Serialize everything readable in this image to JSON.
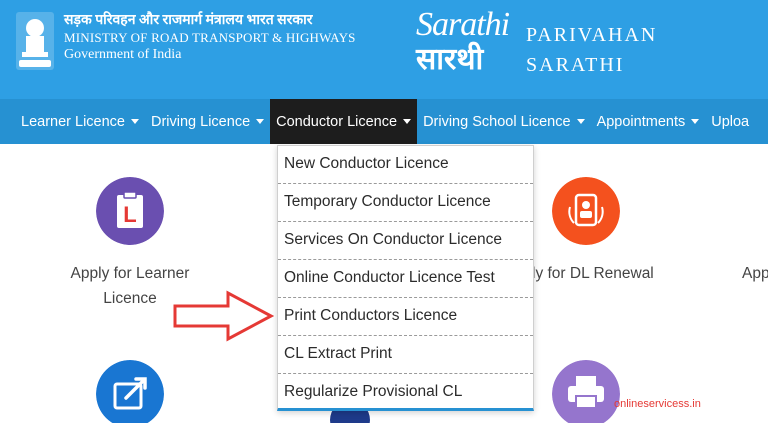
{
  "header": {
    "hindi_title": "सड़क परिवहन और राजमार्ग मंत्रालय भारत सरकार",
    "ministry": "MINISTRY OF ROAD TRANSPORT & HIGHWAYS",
    "government": "Government of India",
    "logo_latin": "Sarathi",
    "logo_devanagari": "सारथी",
    "brand_line1": "PARIVAHAN",
    "brand_line2": "SARATHI"
  },
  "nav": {
    "items": [
      {
        "label": "Learner Licence",
        "active": false
      },
      {
        "label": "Driving Licence",
        "active": false
      },
      {
        "label": "Conductor Licence",
        "active": true
      },
      {
        "label": "Driving School Licence",
        "active": false
      },
      {
        "label": "Appointments",
        "active": false
      },
      {
        "label": "Uploa",
        "active": false
      }
    ]
  },
  "dropdown": {
    "items": [
      "New Conductor Licence",
      "Temporary Conductor Licence",
      "Services On Conductor Licence",
      "Online Conductor Licence Test",
      "Print Conductors Licence",
      "CL Extract Print",
      "Regularize Provisional CL"
    ]
  },
  "tiles": {
    "learner_line1": "Apply for Learner",
    "learner_line2": "Licence",
    "dl_renewal_partial": "ly for DL Renewal",
    "right_partial": "App"
  },
  "watermark": "onlineservicess.in",
  "colors": {
    "header_bg": "#2e9fe4",
    "nav_bg": "#2691d2",
    "nav_active": "#1d1d1d",
    "learner_icon": "#6a4fb0",
    "renewal_icon": "#f4511e",
    "share_icon": "#1976d2",
    "print_icon": "#9575cd",
    "arrow": "#e53935"
  }
}
